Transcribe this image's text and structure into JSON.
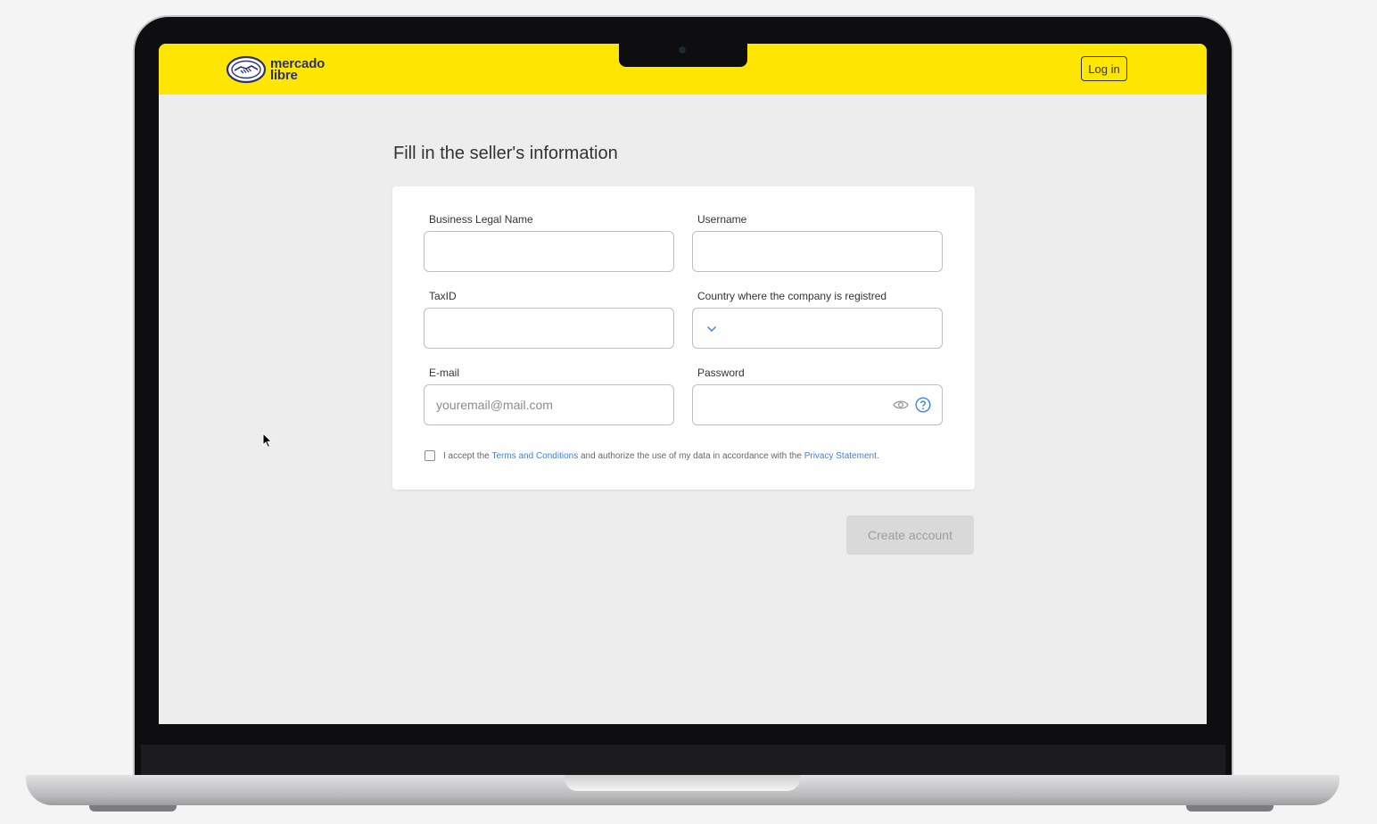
{
  "header": {
    "logo_line1": "mercado",
    "logo_line2": "libre",
    "login_label": "Log in",
    "brand_color": "#ffe600",
    "logo_color": "#2d3277"
  },
  "page": {
    "title": "Fill in the seller's information"
  },
  "form": {
    "business_name": {
      "label": "Business Legal Name",
      "value": ""
    },
    "username": {
      "label": "Username",
      "value": ""
    },
    "tax_id": {
      "label": "TaxID",
      "value": ""
    },
    "country": {
      "label": "Country where the  company is registred",
      "value": "",
      "icon": "chevron-down-icon"
    },
    "email": {
      "label": "E-mail",
      "placeholder": "youremail@mail.com",
      "value": ""
    },
    "password": {
      "label": "Password",
      "value": "",
      "icons": [
        "eye-icon",
        "help-icon"
      ]
    },
    "terms": {
      "checked": false,
      "text_before": "I accept the ",
      "terms_link": "Terms and Conditions",
      "text_middle": " and authorize the use of my data in accordance with the ",
      "privacy_link": "Privacy Statement",
      "text_end": ".",
      "link_color": "#3483fa"
    },
    "create_label": "Create account"
  }
}
